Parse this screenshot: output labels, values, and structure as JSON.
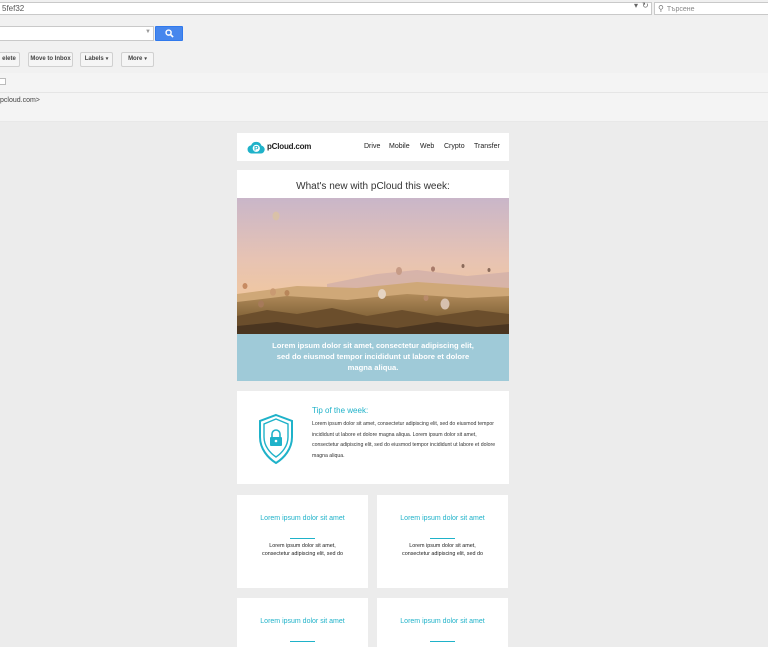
{
  "browser": {
    "url": "5fef32",
    "search_placeholder": "Търсене",
    "dropdown_glyph": "▾",
    "refresh_glyph": "↻",
    "home_glyph": "⌂"
  },
  "toolbar": {
    "delete_label": "elete",
    "move_label": "Move to Inbox",
    "labels_label": "Labels",
    "more_label": "More"
  },
  "message": {
    "sender_fragment": "pcloud.com>"
  },
  "email": {
    "brand": "pCloud.com",
    "nav": [
      "Drive",
      "Mobile",
      "Web",
      "Crypto",
      "Transfer"
    ],
    "headline": "What's new with pCloud this week:",
    "banner_text": "Lorem ipsum dolor sit amet, consectetur adipiscing elit, sed do eiusmod tempor incididunt ut labore et dolore magna aliqua.",
    "tip": {
      "title": "Tip of the week:",
      "body": "Lorem ipsum dolor sit amet, consectetur adipiscing elit, sed do eiusmod tempor incididunt ut labore et dolore magna aliqua. Lorem ipsum dolor sit amet, consectetur adipiscing elit, sed do eiusmod tempor incididunt ut labore et dolore magna aliqua."
    },
    "features": [
      {
        "title": "Lorem ipsum dolor sit amet",
        "body": "Lorem ipsum dolor sit amet, consectetur adipiscing elit, sed do"
      },
      {
        "title": "Lorem ipsum dolor sit amet",
        "body": "Lorem ipsum dolor sit amet, consectetur adipiscing elit, sed do"
      },
      {
        "title": "Lorem ipsum dolor sit amet",
        "body": ""
      },
      {
        "title": "Lorem ipsum dolor sit amet",
        "body": ""
      }
    ],
    "accent_color": "#1fb2c9",
    "banner_color": "#9fcad8"
  }
}
